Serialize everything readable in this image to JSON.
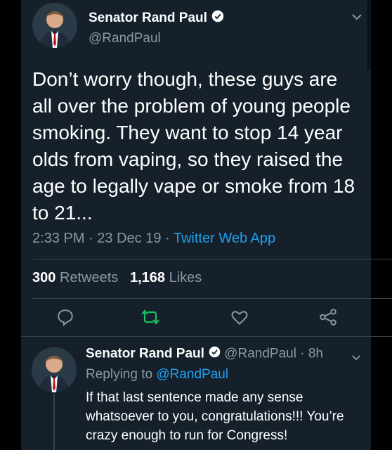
{
  "tweet": {
    "author_name": "Senator Rand Paul",
    "author_handle": "@RandPaul",
    "text": "Don’t worry though, these guys are all over the problem of young people smoking. They want to stop 14 year olds from vaping, so they raised the age to legally vape or smoke from 18 to 21...",
    "time": "2:33 PM",
    "date": "23 Dec 19",
    "separator": " · ",
    "app": "Twitter Web App",
    "retweets_count": "300",
    "retweets_label": "Retweets",
    "likes_count": "1,168",
    "likes_label": "Likes"
  },
  "reply": {
    "author_name": "Senator Rand Paul",
    "author_handle": "@RandPaul",
    "age": " · 8h",
    "replying_label": "Replying to",
    "replying_to": "@RandPaul",
    "text": "If that last sentence made any sense whatsoever to you, congratulations!!! You’re crazy enough to run for Congress!"
  },
  "icons": [
    "verified-badge-icon",
    "chevron-down-icon",
    "reply-icon",
    "retweet-icon",
    "like-icon",
    "share-icon"
  ],
  "colors": {
    "background": "#15202b",
    "accent": "#1da1f2",
    "retweet": "#17bf63",
    "muted": "#8899a6"
  }
}
